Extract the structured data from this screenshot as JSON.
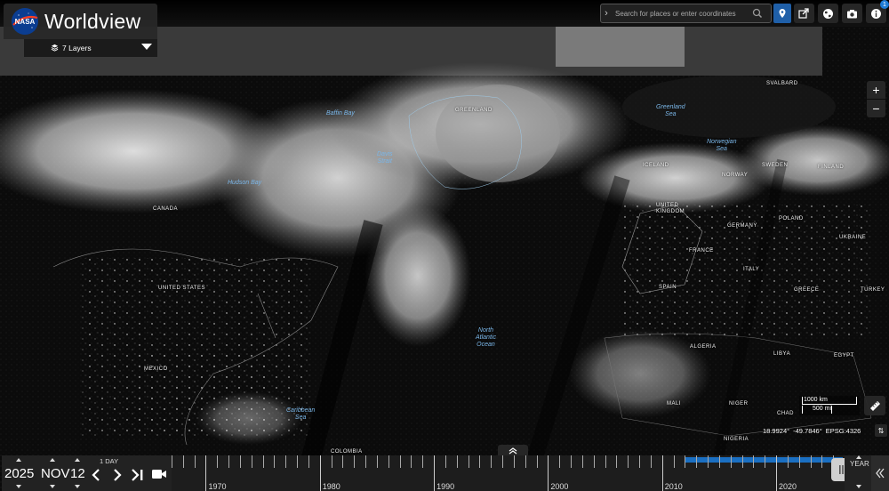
{
  "app": {
    "title": "Worldview",
    "logo_text": "NASA"
  },
  "layers": {
    "label": "7 Layers"
  },
  "search": {
    "placeholder": "Search for places or enter coordinates"
  },
  "toolbar": {
    "info_badge": "1"
  },
  "zoom": {
    "in_label": "+",
    "out_label": "−"
  },
  "map_labels": {
    "greenland": "GREENLAND",
    "svalbard": "SVALBARD",
    "canada": "CANADA",
    "united_states": "UNITED STATES",
    "mexico": "MEXICO",
    "iceland": "ICELAND",
    "sweden": "SWEDEN",
    "finland": "FINLAND",
    "norway": "NORWAY",
    "united_kingdom": "UNITED\nKINGDOM",
    "germany": "GERMANY",
    "poland": "POLAND",
    "ukraine": "UKRAINE",
    "france": "FRANCE",
    "spain": "SPAIN",
    "italy": "ITALY",
    "greece": "GREECE",
    "turkey": "TURKEY",
    "algeria": "ALGERIA",
    "libya": "LIBYA",
    "egypt": "EGYPT",
    "mali": "MALI",
    "niger": "NIGER",
    "chad": "CHAD",
    "nigeria": "NIGERIA",
    "colombia": "COLOMBIA"
  },
  "water_labels": {
    "baffin_bay": "Baffin Bay",
    "davis_strait": "Davis\nStrait",
    "hudson_bay": "Hudson Bay",
    "greenland_sea": "Greenland\nSea",
    "norwegian_sea": "Norwegian\nSea",
    "north_atlantic": "North\nAtlantic\nOcean",
    "caribbean_sea": "Caribbean\nSea"
  },
  "scale": {
    "km": "1000 km",
    "mi": "500 mi"
  },
  "coordinates": {
    "lat": "18.9924°",
    "lon": "-49.7846°",
    "projection": "EPSG:4326"
  },
  "date": {
    "year": "2025",
    "month": "NOV",
    "day": "12",
    "interval": "1 DAY"
  },
  "timeline": {
    "zoom_level": "YEAR",
    "start_year": 1967,
    "end_year": 2025,
    "current_year": 2025.87,
    "data_start_year": 2012,
    "year_labels": [
      "1970",
      "1980",
      "1990",
      "2000",
      "2010",
      "2020"
    ]
  },
  "colors": {
    "accent": "#1f5fa8",
    "data_range": "#1a6fc2",
    "water_label": "#7ab6e8",
    "panel": "#282828"
  }
}
